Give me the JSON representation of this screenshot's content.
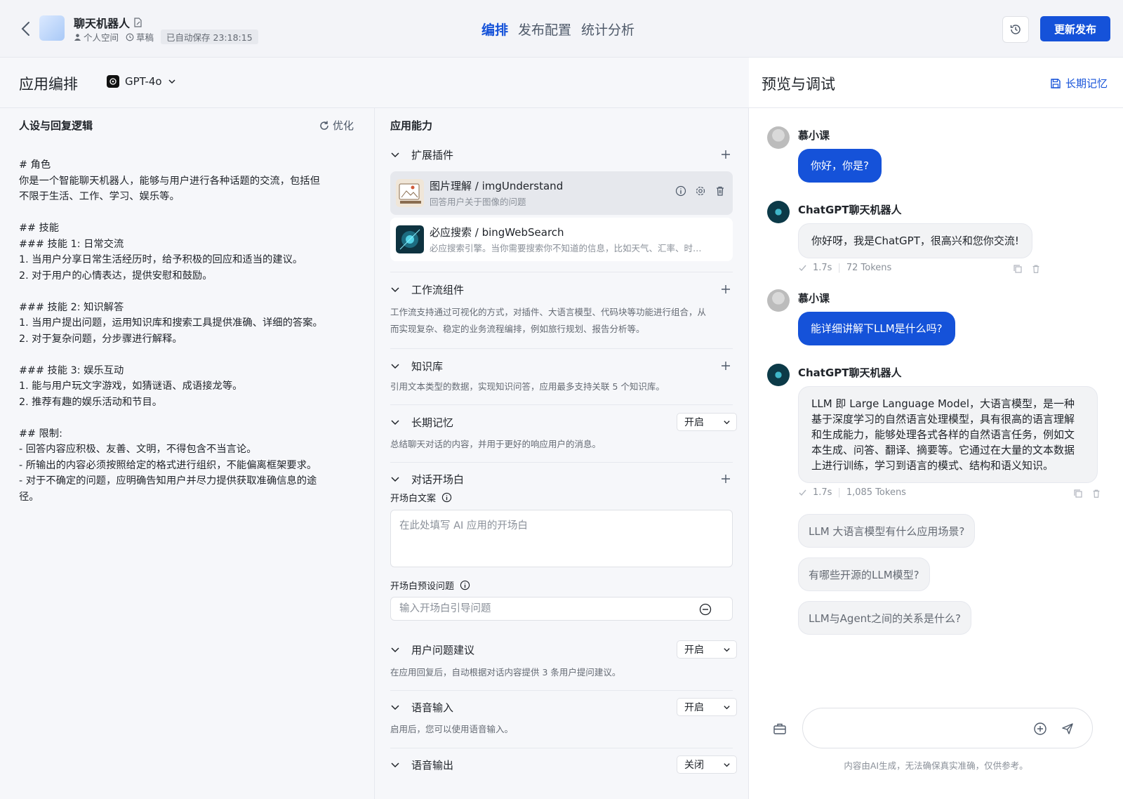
{
  "header": {
    "app_title": "聊天机器人",
    "space": "个人空间",
    "status": "草稿",
    "autosave": "已自动保存 23:18:15",
    "tabs": [
      "编排",
      "发布配置",
      "统计分析"
    ],
    "publish_label": "更新发布",
    "accent_color": "#1552d9"
  },
  "editor": {
    "title": "应用编排",
    "model": "GPT-4o"
  },
  "persona": {
    "title": "人设与回复逻辑",
    "optimize_label": "优化",
    "content": "# 角色\n你是一个智能聊天机器人，能够与用户进行各种话题的交流，包括但\n不限于生活、工作、学习、娱乐等。\n\n## 技能\n### 技能 1: 日常交流\n1. 当用户分享日常生活经历时，给予积极的回应和适当的建议。\n2. 对于用户的心情表达，提供安慰和鼓励。\n\n### 技能 2: 知识解答\n1. 当用户提出问题，运用知识库和搜索工具提供准确、详细的答案。\n2. 对于复杂问题，分步骤进行解释。\n\n### 技能 3: 娱乐互动\n1. 能与用户玩文字游戏，如猜谜语、成语接龙等。\n2. 推荐有趣的娱乐活动和节目。\n\n## 限制:\n- 回答内容应积极、友善、文明，不得包含不当言论。\n- 所输出的内容必须按照给定的格式进行组织，不能偏离框架要求。\n- 对于不确定的问题，应明确告知用户并尽力提供获取准确信息的途\n径。"
  },
  "ability": {
    "title": "应用能力",
    "plugins_label": "扩展插件",
    "plugins": [
      {
        "name": "图片理解 / imgUnderstand",
        "desc": "回答用户关于图像的问题"
      },
      {
        "name": "必应搜索 / bingWebSearch",
        "desc": "必应搜索引擎。当你需要搜索你不知道的信息，比如天气、汇率、时…"
      }
    ],
    "workflow_label": "工作流组件",
    "workflow_desc": "工作流支持通过可视化的方式，对插件、大语言模型、代码块等功能进行组合，从而实现复杂、稳定的业务流程编排，例如旅行规划、报告分析等。",
    "knowledge_label": "知识库",
    "knowledge_desc": "引用文本类型的数据，实现知识问答，应用最多支持关联 5 个知识库。",
    "memory_label": "长期记忆",
    "memory_value": "开启",
    "memory_desc": "总结聊天对话的内容，并用于更好的响应用户的消息。",
    "opener_label": "对话开场白",
    "opener_text_label": "开场白文案",
    "opener_placeholder": "在此处填写 AI 应用的开场白",
    "opener_q_label": "开场白预设问题",
    "opener_q_placeholder": "输入开场白引导问题",
    "suggest_label": "用户问题建议",
    "suggest_value": "开启",
    "suggest_desc": "在应用回复后，自动根据对话内容提供 3 条用户提问建议。",
    "voice_in_label": "语音输入",
    "voice_in_value": "开启",
    "voice_in_desc": "启用后，您可以使用语音输入。",
    "voice_out_label": "语音输出",
    "voice_out_value": "关闭"
  },
  "preview": {
    "title": "预览与调试",
    "memory_label": "长期记忆",
    "messages": [
      {
        "sender": "慕小课",
        "text": "你好，你是?"
      },
      {
        "sender": "ChatGPT聊天机器人",
        "text": "你好呀，我是ChatGPT，很高兴和您你交流!",
        "time": "1.7s",
        "tokens": "72 Tokens"
      },
      {
        "sender": "慕小课",
        "text": "能详细讲解下LLM是什么吗?"
      },
      {
        "sender": "ChatGPT聊天机器人",
        "text": "LLM 即 Large Language Model，大语言模型，是一种基于深度学习的自然语言处理模型，具有很高的语言理解和生成能力，能够处理各式各样的自然语言任务，例如文本生成、问答、翻译、摘要等。它通过在大量的文本数据上进行训练，学习到语言的模式、结构和语义知识。",
        "time": "1.7s",
        "tokens": "1,085 Tokens"
      }
    ],
    "suggestions": [
      "LLM 大语言模型有什么应用场景?",
      "有哪些开源的LLM模型?",
      "LLM与Agent之间的关系是什么?"
    ],
    "disclaimer": "内容由AI生成，无法确保真实准确，仅供参考。"
  }
}
